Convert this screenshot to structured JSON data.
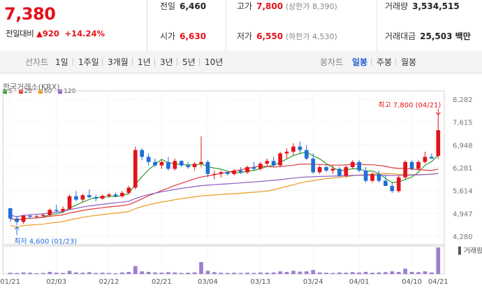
{
  "price": {
    "current": "7,380",
    "change_label": "전일대비",
    "change_arrow": "▲",
    "change_amount": "920",
    "change_pct": "+14.24%"
  },
  "stats": {
    "prev_close": {
      "label": "전일",
      "value": "6,460"
    },
    "open": {
      "label": "시가",
      "value": "6,630"
    },
    "high": {
      "label": "고가",
      "value": "7,800",
      "limit": "(상한가 8,390)"
    },
    "low": {
      "label": "저가",
      "value": "6,550",
      "limit": "(하한가 4,530)"
    },
    "volume": {
      "label": "거래량",
      "value": "3,534,515"
    },
    "amount": {
      "label": "거래대금",
      "value": "25,503 백만"
    }
  },
  "tabs": {
    "line_chart": "선차트",
    "periods": [
      "1일",
      "1주일",
      "3개월",
      "1년",
      "3년",
      "5년",
      "10년"
    ],
    "candle_chart": "봉차트",
    "candle_periods": [
      "일봉",
      "주봉",
      "월봉"
    ],
    "active": "일봉"
  },
  "chart_header": {
    "exchange": "한국거래소(KRX)",
    "ma_legend": [
      {
        "label": "5",
        "color": "#2e9e2e"
      },
      {
        "label": "20",
        "color": "#e23a3a"
      },
      {
        "label": "60",
        "color": "#e89a1e"
      },
      {
        "label": "120",
        "color": "#8a5cc7"
      }
    ]
  },
  "annotations": {
    "high_note": "최고 7,800 (04/21)",
    "low_note": "최저 4,600 (01/23)",
    "volume_label": "거래량"
  },
  "colors": {
    "up": "#e3121b",
    "down": "#1f6fd6",
    "active_tab": "#1a5bd8"
  },
  "chart_data": {
    "type": "candlestick",
    "y_ticks": [
      "8,282",
      "7,615",
      "6,948",
      "6,281",
      "5,614",
      "4,947",
      "4,280"
    ],
    "ylim": [
      4280,
      8282
    ],
    "x_tick_labels": [
      "01/21",
      "02/03",
      "02/12",
      "02/21",
      "03/04",
      "03/13",
      "03/24",
      "04/01",
      "04/10",
      "04/21"
    ],
    "candles": [
      [
        5100,
        5110,
        4700,
        4800
      ],
      [
        4800,
        4880,
        4600,
        4700
      ],
      [
        4700,
        4900,
        4650,
        4880
      ],
      [
        4880,
        4920,
        4780,
        4850
      ],
      [
        4850,
        4900,
        4800,
        4870
      ],
      [
        4870,
        4950,
        4820,
        4900
      ],
      [
        4900,
        5100,
        4850,
        5050
      ],
      [
        5050,
        5200,
        4980,
        5020
      ],
      [
        5020,
        5150,
        4950,
        5080
      ],
      [
        5080,
        5500,
        5050,
        5450
      ],
      [
        5450,
        5600,
        5300,
        5350
      ],
      [
        5350,
        5520,
        5280,
        5480
      ],
      [
        5480,
        5650,
        5400,
        5420
      ],
      [
        5420,
        5500,
        5300,
        5380
      ],
      [
        5380,
        5500,
        5350,
        5460
      ],
      [
        5460,
        5550,
        5400,
        5500
      ],
      [
        5500,
        5560,
        5420,
        5450
      ],
      [
        5450,
        5600,
        5400,
        5550
      ],
      [
        5550,
        5750,
        5500,
        5700
      ],
      [
        5700,
        6900,
        5650,
        6800
      ],
      [
        6800,
        6850,
        6500,
        6600
      ],
      [
        6600,
        6700,
        6350,
        6450
      ],
      [
        6450,
        6550,
        6300,
        6350
      ],
      [
        6350,
        6500,
        6250,
        6450
      ],
      [
        6450,
        6600,
        6200,
        6250
      ],
      [
        6250,
        6550,
        6200,
        6480
      ],
      [
        6480,
        6500,
        6300,
        6350
      ],
      [
        6350,
        6450,
        6250,
        6300
      ],
      [
        6300,
        6450,
        6200,
        6400
      ],
      [
        6400,
        7200,
        6300,
        6450
      ],
      [
        6450,
        6500,
        6000,
        6100
      ],
      [
        6100,
        6200,
        5950,
        6100
      ],
      [
        6100,
        6200,
        6000,
        6150
      ],
      [
        6150,
        6200,
        6050,
        6100
      ],
      [
        6100,
        6250,
        6050,
        6200
      ],
      [
        6200,
        6300,
        6100,
        6150
      ],
      [
        6150,
        6350,
        6100,
        6300
      ],
      [
        6300,
        6450,
        6200,
        6250
      ],
      [
        6250,
        6450,
        6200,
        6400
      ],
      [
        6400,
        6550,
        6300,
        6480
      ],
      [
        6480,
        6600,
        6300,
        6350
      ],
      [
        6350,
        6750,
        6300,
        6700
      ],
      [
        6700,
        6850,
        6550,
        6750
      ],
      [
        6750,
        7000,
        6650,
        6900
      ],
      [
        6900,
        7050,
        6700,
        6800
      ],
      [
        6800,
        6950,
        6500,
        6550
      ],
      [
        6550,
        6700,
        6100,
        6150
      ],
      [
        6150,
        6350,
        6100,
        6300
      ],
      [
        6300,
        6350,
        6150,
        6200
      ],
      [
        6200,
        6350,
        6100,
        6250
      ],
      [
        6250,
        6300,
        6000,
        6050
      ],
      [
        6050,
        6350,
        6000,
        6300
      ],
      [
        6300,
        6500,
        6250,
        6450
      ],
      [
        6450,
        6500,
        6150,
        6200
      ],
      [
        6200,
        6300,
        5850,
        5900
      ],
      [
        5900,
        6150,
        5850,
        6100
      ],
      [
        6100,
        6200,
        5850,
        5900
      ],
      [
        5900,
        6050,
        5750,
        5750
      ],
      [
        5750,
        5850,
        5550,
        5600
      ],
      [
        5600,
        6050,
        5550,
        6000
      ],
      [
        6000,
        6500,
        5950,
        6450
      ],
      [
        6450,
        6500,
        6200,
        6250
      ],
      [
        6250,
        6500,
        6200,
        6450
      ],
      [
        6450,
        6750,
        6400,
        6600
      ],
      [
        6600,
        6700,
        6550,
        6550
      ],
      [
        6630,
        7800,
        6550,
        7380
      ]
    ],
    "volume": [
      0.05,
      0.04,
      0.06,
      0.05,
      0.03,
      0.04,
      0.08,
      0.05,
      0.04,
      0.12,
      0.06,
      0.05,
      0.07,
      0.04,
      0.05,
      0.04,
      0.03,
      0.06,
      0.08,
      0.3,
      0.1,
      0.08,
      0.06,
      0.05,
      0.07,
      0.06,
      0.04,
      0.05,
      0.06,
      0.45,
      0.12,
      0.07,
      0.05,
      0.04,
      0.05,
      0.04,
      0.05,
      0.04,
      0.06,
      0.05,
      0.06,
      0.1,
      0.08,
      0.12,
      0.09,
      0.1,
      0.15,
      0.06,
      0.05,
      0.04,
      0.06,
      0.05,
      0.07,
      0.06,
      0.08,
      0.05,
      0.06,
      0.07,
      0.1,
      0.08,
      0.2,
      0.08,
      0.07,
      0.1,
      0.06,
      1.0
    ],
    "ma5_color": "#2e9e2e",
    "ma20_color": "#e23a3a",
    "ma60_color": "#e89a1e",
    "ma120_color": "#8a5cc7"
  }
}
